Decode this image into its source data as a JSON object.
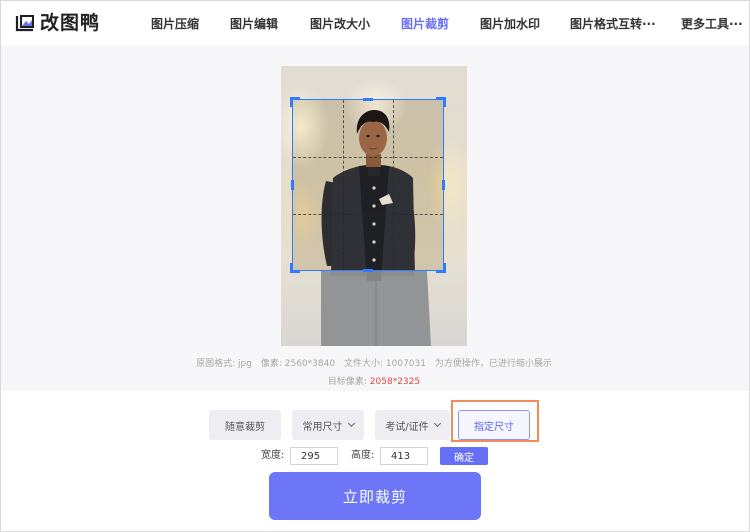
{
  "app": {
    "name": "改图鸭"
  },
  "nav": {
    "items": [
      {
        "label": "图片压缩"
      },
      {
        "label": "图片编辑"
      },
      {
        "label": "图片改大小"
      },
      {
        "label": "图片裁剪"
      },
      {
        "label": "图片加水印"
      },
      {
        "label": "图片格式互转···"
      },
      {
        "label": "更多工具···"
      }
    ],
    "active_index": 3
  },
  "image_info": {
    "format_label": "原图格式:",
    "format_value": "jpg",
    "pixels_label": "像素:",
    "pixels_value": "2560*3840",
    "size_label": "文件大小:",
    "size_value": "1007031",
    "note": "为方便操作，已进行缩小展示",
    "target_label": "目标像素:",
    "target_value": "2058*2325"
  },
  "crop_modes": {
    "free": "随意裁剪",
    "common": "常用尺寸",
    "exam": "考试/证件",
    "custom": "指定尺寸"
  },
  "dimensions": {
    "width_label": "宽度:",
    "width_value": "295",
    "height_label": "高度:",
    "height_value": "413",
    "confirm_label": "确定"
  },
  "actions": {
    "crop_now": "立即裁剪"
  },
  "colors": {
    "accent": "#6770f5",
    "crop_border": "#2f7bff",
    "target_value": "#e04848",
    "highlight": "#f28a5b"
  }
}
